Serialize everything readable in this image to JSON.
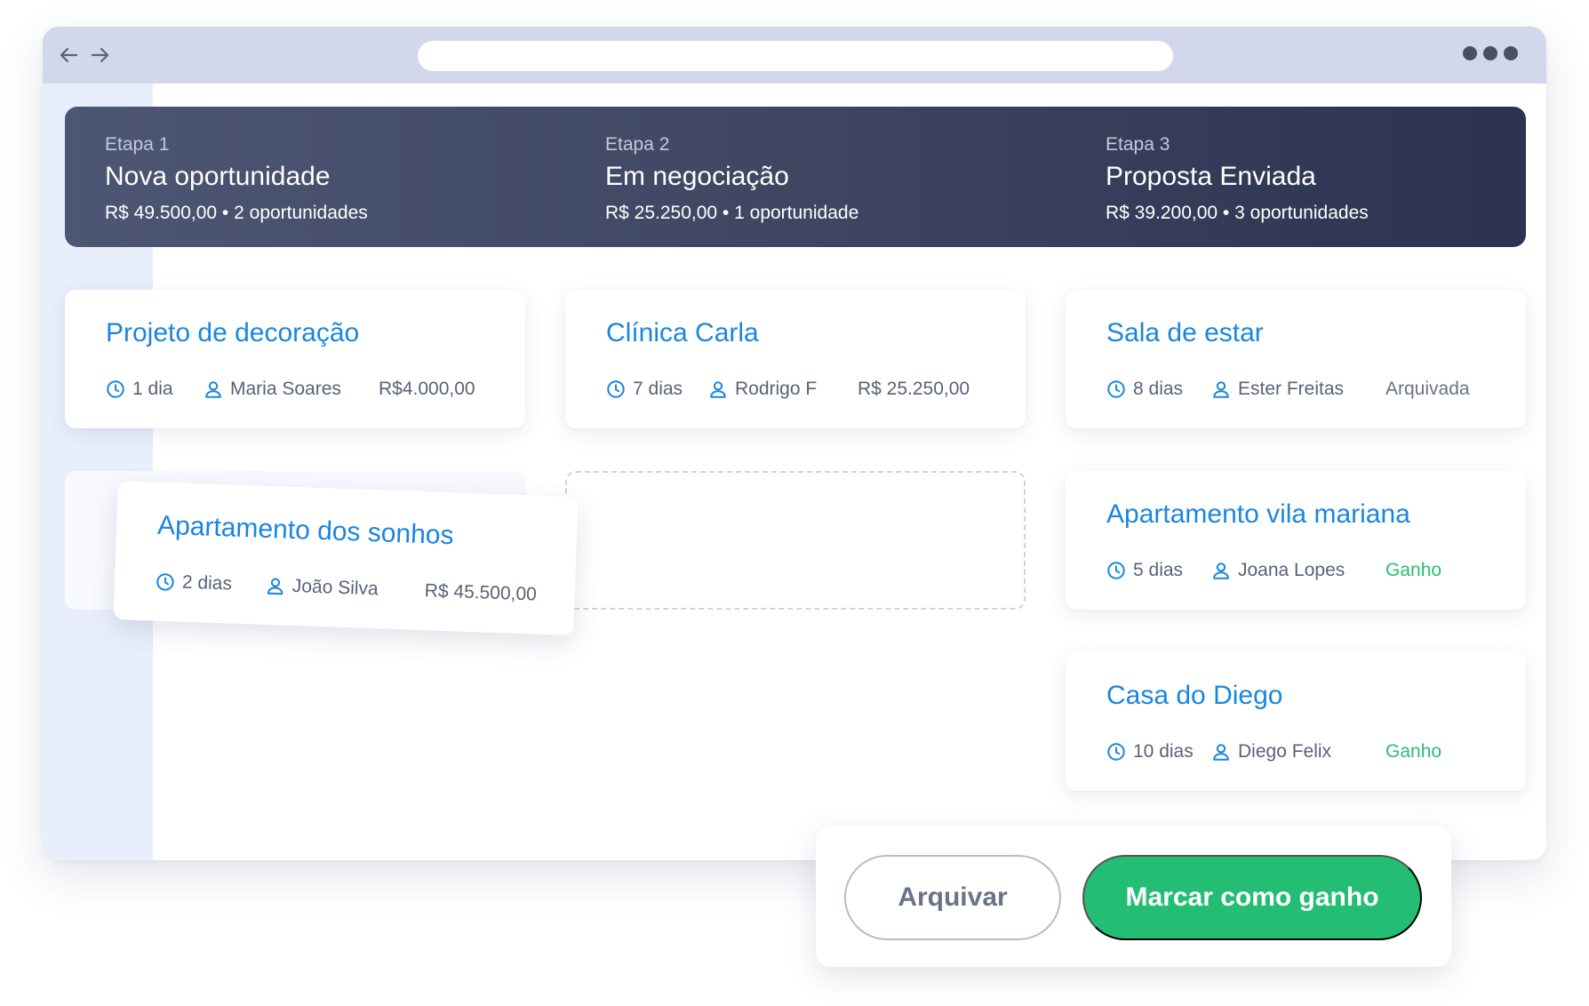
{
  "browser": {
    "icons": {
      "back": "arrow-left-icon",
      "forward": "arrow-right-icon",
      "menu": "more-dots-icon"
    }
  },
  "stages": [
    {
      "label": "Etapa 1",
      "name": "Nova oportunidade",
      "summary": "R$ 49.500,00 • 2 oportunidades"
    },
    {
      "label": "Etapa 2",
      "name": "Em negociação",
      "summary": "R$ 25.250,00 • 1 oportunidade"
    },
    {
      "label": "Etapa 3",
      "name": "Proposta Enviada",
      "summary": "R$ 39.200,00 • 3 oportunidades"
    }
  ],
  "cards": {
    "projeto": {
      "title": "Projeto de decoração",
      "days": "1 dia",
      "person": "Maria Soares",
      "extra": "R$4.000,00"
    },
    "clinica": {
      "title": "Clínica Carla",
      "days": "7 dias",
      "person": "Rodrigo F",
      "extra": "R$ 25.250,00"
    },
    "sala": {
      "title": "Sala de estar",
      "days": "8 dias",
      "person": "Ester Freitas",
      "extra": "Arquivada"
    },
    "apartamento_vila": {
      "title": "Apartamento vila mariana",
      "days": "5 dias",
      "person": "Joana Lopes",
      "extra": "Ganho"
    },
    "casa_diego": {
      "title": "Casa do Diego",
      "days": "10 dias",
      "person": "Diego Felix",
      "extra": "Ganho"
    },
    "dragging": {
      "title": "Apartamento dos sonhos",
      "days": "2 dias",
      "person": "João Silva",
      "extra": "R$ 45.500,00"
    }
  },
  "actions": {
    "archive": "Arquivar",
    "mark_won": "Marcar como ganho"
  },
  "colors": {
    "accent": "#1b86e0",
    "won": "#23be74",
    "header_dark": "#2c3350",
    "sidebar": "#e8eefb"
  }
}
